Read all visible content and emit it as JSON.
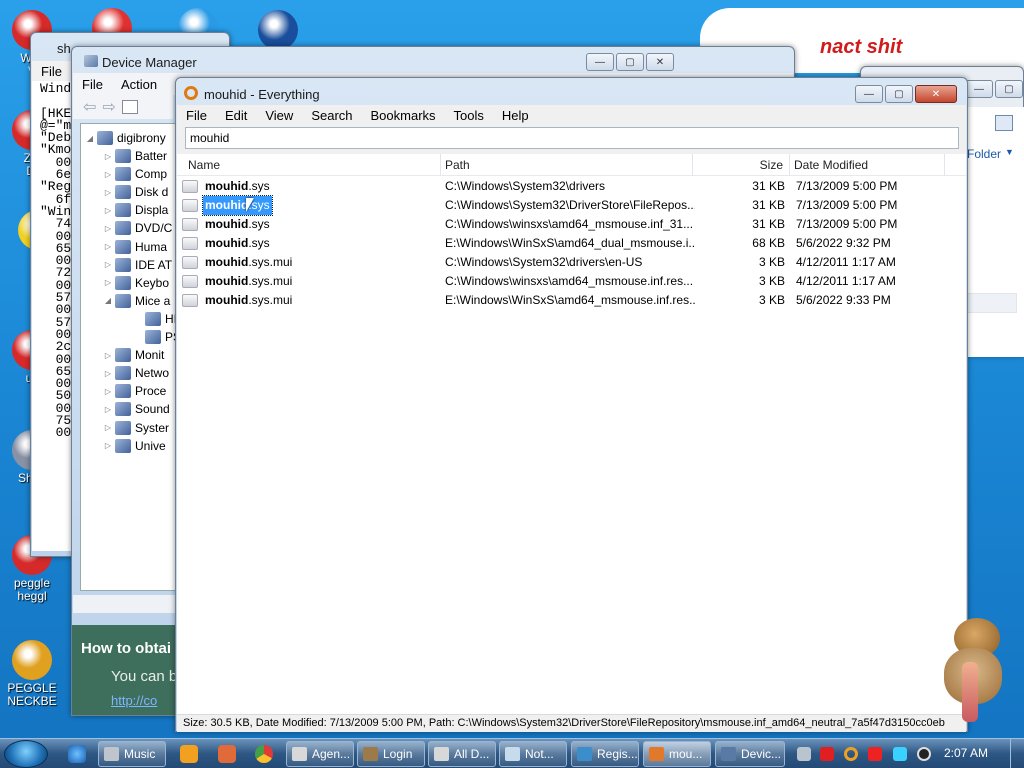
{
  "desktop": {
    "icons": [
      {
        "label": "WIN",
        "color": "#d62a2a"
      },
      {
        "label": "ZO",
        "color": "#d62a2a"
      },
      {
        "label": "uk",
        "color": "#d62a2a"
      },
      {
        "label": "Shop",
        "color": "#8892a6"
      },
      {
        "label": "peggle",
        "color": "#d62a2a"
      },
      {
        "label": "PEGGLE",
        "color": "#e0a020"
      }
    ],
    "icon_sublabels": [
      "V",
      "Di",
      "",
      "",
      "heggl",
      "NECKBE"
    ],
    "banner_text": "nact shit"
  },
  "regedit": {
    "title": "sh",
    "menu": "File",
    "lines": [
      "Wind",
      "",
      "[HKE",
      "@=\"m",
      "\"Deb",
      "\"Kmo",
      "  00",
      "  6e",
      "\"Reg",
      "  6f",
      "\"Win",
      "  74",
      "  00",
      "  65",
      "  00",
      "  72",
      "  00",
      "  57",
      "  00",
      "  57",
      "  00",
      "  2c",
      "  00",
      "  65",
      "  00",
      "  50",
      "  00",
      "  75",
      "  00"
    ]
  },
  "device_manager": {
    "title": "Device Manager",
    "menu": [
      "File",
      "Action"
    ],
    "root": "digibrony",
    "items": [
      "Batter",
      "Comp",
      "Disk d",
      "Displa",
      "DVD/C",
      "Huma",
      "IDE AT",
      "Keybo",
      "Mice a",
      "HI",
      "PS",
      "Monit",
      "Netwo",
      "Proce",
      "Sound",
      "Syster",
      "Unive"
    ],
    "help_heading": "How to obtai",
    "help_text": "You can b",
    "help_link": "http://co"
  },
  "everything": {
    "title": "mouhid - Everything",
    "menu": [
      "File",
      "Edit",
      "View",
      "Search",
      "Bookmarks",
      "Tools",
      "Help"
    ],
    "search_value": "mouhid",
    "columns": {
      "name": "Name",
      "path": "Path",
      "size": "Size",
      "date": "Date Modified"
    },
    "rows": [
      {
        "name_bold": "mouhid",
        "name_rest": ".sys",
        "path": "C:\\Windows\\System32\\drivers",
        "size": "31 KB",
        "date": "7/13/2009 5:00 PM"
      },
      {
        "name_bold": "mouhid",
        "name_rest": ".sys",
        "path": "C:\\Windows\\System32\\DriverStore\\FileRepos...",
        "size": "31 KB",
        "date": "7/13/2009 5:00 PM"
      },
      {
        "name_bold": "mouhid",
        "name_rest": ".sys",
        "path": "C:\\Windows\\winsxs\\amd64_msmouse.inf_31...",
        "size": "31 KB",
        "date": "7/13/2009 5:00 PM"
      },
      {
        "name_bold": "mouhid",
        "name_rest": ".sys",
        "path": "E:\\Windows\\WinSxS\\amd64_dual_msmouse.i...",
        "size": "68 KB",
        "date": "5/6/2022 9:32 PM"
      },
      {
        "name_bold": "mouhid",
        "name_rest": ".sys.mui",
        "path": "C:\\Windows\\System32\\drivers\\en-US",
        "size": "3 KB",
        "date": "4/12/2011 1:17 AM"
      },
      {
        "name_bold": "mouhid",
        "name_rest": ".sys.mui",
        "path": "C:\\Windows\\winsxs\\amd64_msmouse.inf.res...",
        "size": "3 KB",
        "date": "4/12/2011 1:17 AM"
      },
      {
        "name_bold": "mouhid",
        "name_rest": ".sys.mui",
        "path": "E:\\Windows\\WinSxS\\amd64_msmouse.inf.res...",
        "size": "3 KB",
        "date": "5/6/2022 9:33 PM"
      }
    ],
    "status": "Size: 30.5 KB, Date Modified: 7/13/2009 5:00 PM, Path: C:\\Windows\\System32\\DriverStore\\FileRepository\\msmouse.inf_amd64_neutral_7a5f47d3150cc0eb"
  },
  "explorer_bg": {
    "folder_label": "Folder"
  },
  "taskbar": {
    "buttons": [
      {
        "label": "Music",
        "color": "#c0c4cc"
      },
      {
        "label": "Agen...",
        "color": "#d8d8d8"
      },
      {
        "label": "Login",
        "color": "#9d7a4a"
      },
      {
        "label": "All D...",
        "color": "#d8d8d8"
      },
      {
        "label": "Not...",
        "color": "#c6dcec"
      },
      {
        "label": "Regis...",
        "color": "#3b8ec9"
      },
      {
        "label": "mou...",
        "color": "#e07a2a"
      },
      {
        "label": "Devic...",
        "color": "#5a7aa6"
      }
    ],
    "clock": "2:07 AM"
  }
}
